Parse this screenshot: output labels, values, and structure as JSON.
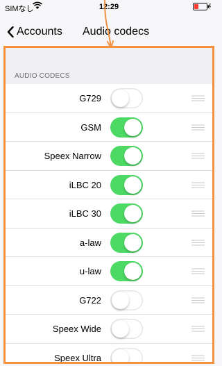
{
  "status_bar": {
    "carrier": "SIMなし",
    "time": "12:29",
    "icons": [
      "wifi-icon",
      "battery-icon"
    ]
  },
  "nav": {
    "back_label": "Accounts",
    "title": "Audio codecs",
    "back_icon": "chevron-left-icon"
  },
  "section": {
    "header": "AUDIO CODECS"
  },
  "codecs": [
    {
      "name": "G729",
      "enabled": false
    },
    {
      "name": "GSM",
      "enabled": true
    },
    {
      "name": "Speex Narrow",
      "enabled": true
    },
    {
      "name": "iLBC 20",
      "enabled": true
    },
    {
      "name": "iLBC 30",
      "enabled": true
    },
    {
      "name": "a-law",
      "enabled": true
    },
    {
      "name": "u-law",
      "enabled": true
    },
    {
      "name": "G722",
      "enabled": false
    },
    {
      "name": "Speex Wide",
      "enabled": false
    },
    {
      "name": "Speex Ultra",
      "enabled": false
    }
  ],
  "colors": {
    "toggle_on": "#4cd964",
    "annotation": "#f2913f",
    "battery_low": "#ff3b30"
  }
}
